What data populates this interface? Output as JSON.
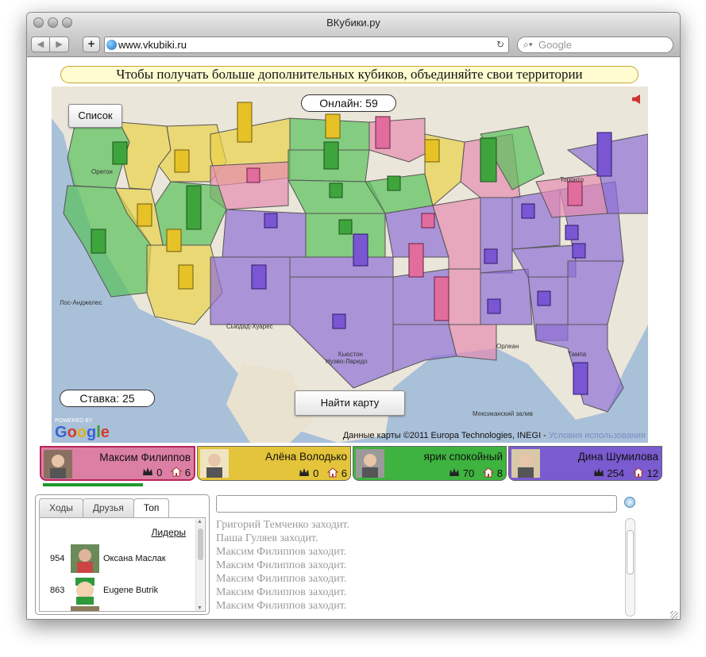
{
  "window": {
    "title": "ВКубики.ру"
  },
  "browser": {
    "back_icon": "◀",
    "forward_icon": "▶",
    "new_tab_icon": "+",
    "url": "www.vkubiki.ru",
    "reload_icon": "↻",
    "search_placeholder": "Google"
  },
  "banner": {
    "text": "Чтобы получать больше дополнительных кубиков, объединяйте свои территории"
  },
  "map": {
    "list_button": "Список",
    "online_text": "Онлайн: 59",
    "stake_text": "Ставка: 25",
    "find_map_button": "Найти карту",
    "copyright_text": "Данные карты ©2011 Europa Technologies, INEGI - ",
    "terms_link": "Условия использования",
    "powered_by": "POWERED BY",
    "google_logo": "Google",
    "colors": {
      "pink": "#e68bb0",
      "yellow": "#e9d14a",
      "green": "#58c05a",
      "purple": "#8f6fd6"
    }
  },
  "players": [
    {
      "name": "Максим Филиппов",
      "crowns": "0",
      "houses": "6",
      "color": "#dc7fa4",
      "active": true
    },
    {
      "name": "Алёна Володько",
      "crowns": "0",
      "houses": "6",
      "color": "#e3c43a",
      "active": false
    },
    {
      "name": "ярик спокойный",
      "crowns": "70",
      "houses": "8",
      "color": "#3eb33f",
      "active": false
    },
    {
      "name": "Дина Шумилова",
      "crowns": "254",
      "houses": "12",
      "color": "#7a5bd0",
      "active": false
    }
  ],
  "tabs": [
    {
      "label": "Ходы"
    },
    {
      "label": "Друзья"
    },
    {
      "label": "Топ",
      "selected": true
    }
  ],
  "leaderboard": {
    "link": "Лидеры",
    "rows": [
      {
        "score": "954",
        "name": "Оксана Маслак"
      },
      {
        "score": "863",
        "name": "Eugene Butrik"
      }
    ]
  },
  "chat": {
    "messages": [
      "Григорий Темченко заходит.",
      "Паша Гуляев заходит.",
      "Максим Филиппов заходит.",
      "Максим Филиппов заходит.",
      "Максим Филиппов заходит.",
      "Максим Филиппов заходит.",
      "Максим Филиппов заходит."
    ]
  }
}
